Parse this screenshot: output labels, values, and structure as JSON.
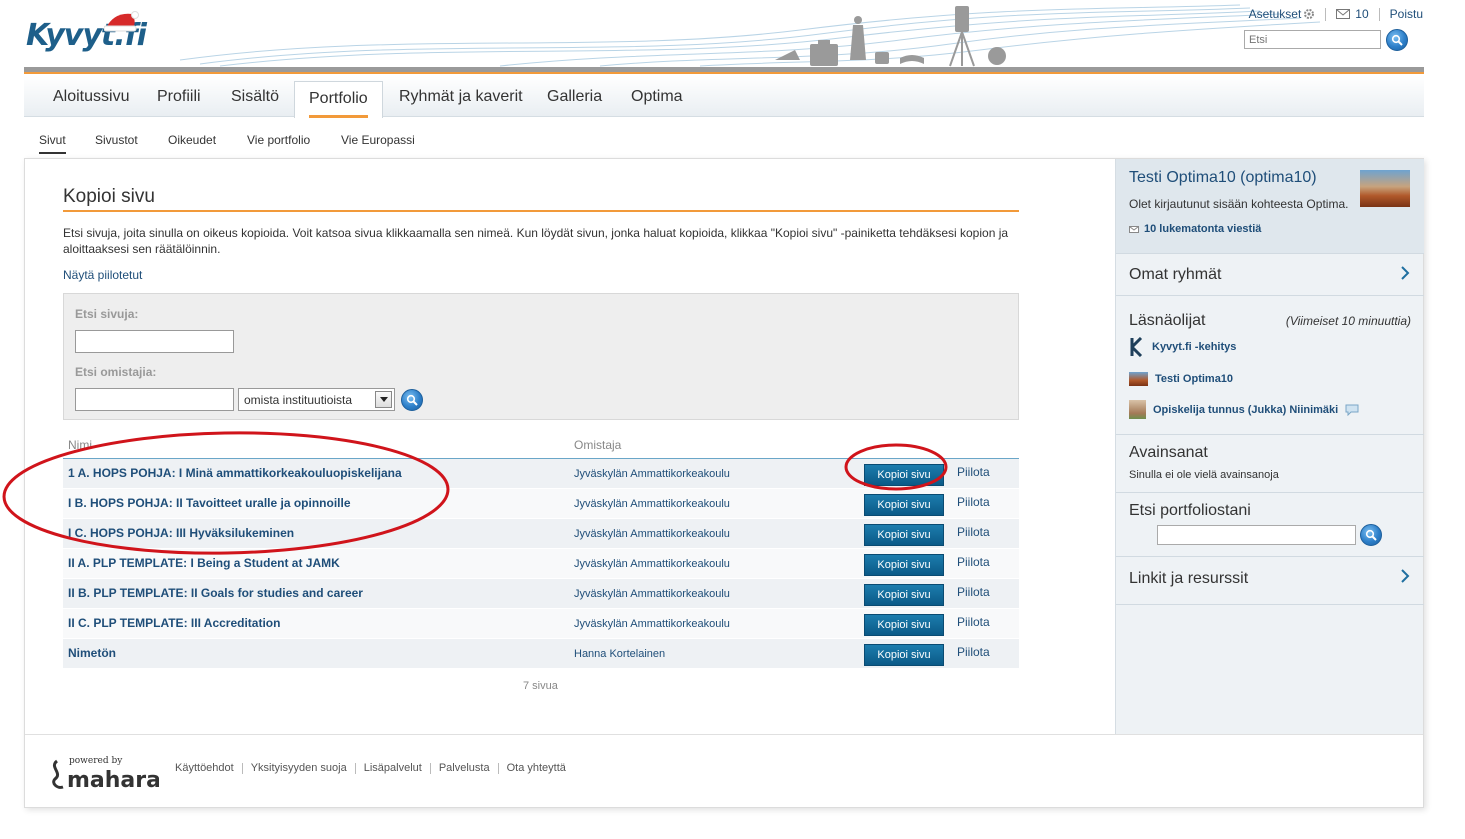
{
  "header": {
    "logo": "Kyvyt.fi",
    "settings_label": "Asetukset",
    "inbox_count": "10",
    "logout_label": "Poistu",
    "search_placeholder": "Etsi"
  },
  "main_nav": {
    "tabs": [
      {
        "label": "Aloitussivu"
      },
      {
        "label": "Profiili"
      },
      {
        "label": "Sisältö"
      },
      {
        "label": "Portfolio"
      },
      {
        "label": "Ryhmät ja kaverit"
      },
      {
        "label": "Galleria"
      },
      {
        "label": "Optima"
      }
    ],
    "active": "Portfolio"
  },
  "sub_nav": {
    "items": [
      {
        "label": "Sivut"
      },
      {
        "label": "Sivustot"
      },
      {
        "label": "Oikeudet"
      },
      {
        "label": "Vie portfolio"
      },
      {
        "label": "Vie Europassi"
      }
    ],
    "active": "Sivut"
  },
  "main": {
    "title": "Kopioi sivu",
    "intro": "Etsi sivuja, joita sinulla on oikeus kopioida. Voit katsoa sivua klikkaamalla sen nimeä. Kun löydät sivun, jonka haluat kopioida, klikkaa \"Kopioi sivu\" -painiketta tehdäksesi kopion ja aloittaaksesi sen räätälöinnin.",
    "show_hidden": "Näytä piilotetut",
    "search_pages_label": "Etsi sivuja:",
    "search_pages_value": "",
    "search_owners_label": "Etsi omistajia:",
    "search_owners_value": "",
    "owner_scope": "omista instituutioista",
    "table": {
      "col_name": "Nimi",
      "col_owner": "Omistaja",
      "copy_label": "Kopioi sivu",
      "hide_label": "Piilota",
      "rows": [
        {
          "name": "1 A. HOPS POHJA: I Minä ammattikorkeakouluopiskelijana",
          "owner": "Jyväskylän Ammattikorkeakoulu"
        },
        {
          "name": "I B. HOPS POHJA: II Tavoitteet uralle ja opinnoille",
          "owner": "Jyväskylän Ammattikorkeakoulu"
        },
        {
          "name": "I C. HOPS POHJA: III Hyväksilukeminen",
          "owner": "Jyväskylän Ammattikorkeakoulu"
        },
        {
          "name": "II A. PLP TEMPLATE: I Being a Student at JAMK",
          "owner": "Jyväskylän Ammattikorkeakoulu"
        },
        {
          "name": "II B. PLP TEMPLATE: II Goals for studies and career",
          "owner": "Jyväskylän Ammattikorkeakoulu"
        },
        {
          "name": "II C. PLP TEMPLATE: III Accreditation",
          "owner": "Jyväskylän Ammattikorkeakoulu"
        },
        {
          "name": "Nimetön",
          "owner": "Hanna Kortelainen"
        }
      ]
    },
    "page_count": "7 sivua"
  },
  "sidebar": {
    "user_name": "Testi Optima10 (optima10)",
    "login_note": "Olet kirjautunut sisään kohteesta Optima.",
    "unread": "10 lukematonta viestiä",
    "groups_title": "Omat ryhmät",
    "online_title": "Läsnäolijat",
    "online_note": "(Viimeiset 10 minuuttia)",
    "online_users": [
      {
        "name": "Kyvyt.fi -kehitys"
      },
      {
        "name": "Testi Optima10"
      },
      {
        "name": "Opiskelija tunnus (Jukka) Niinimäki"
      }
    ],
    "keywords_title": "Avainsanat",
    "keywords_empty": "Sinulla ei ole vielä avainsanoja",
    "portfolio_search_title": "Etsi portfoliostani",
    "links_title": "Linkit ja resurssit"
  },
  "footer": {
    "powered_by": "powered by",
    "brand": "mahara",
    "links": [
      {
        "label": "Käyttöehdot"
      },
      {
        "label": "Yksityisyyden suoja"
      },
      {
        "label": "Lisäpalvelut"
      },
      {
        "label": "Palvelusta"
      },
      {
        "label": "Ota yhteyttä"
      }
    ]
  },
  "colors": {
    "accent_orange": "#f29a3a",
    "link_blue": "#1f4e79",
    "button_blue": "#0b5a87",
    "annotation_red": "#d0141b"
  },
  "icons": [
    "gear-icon",
    "mail-icon",
    "search-icon",
    "chevron-right-icon",
    "speech-bubble-icon",
    "dropdown-arrow-icon"
  ]
}
